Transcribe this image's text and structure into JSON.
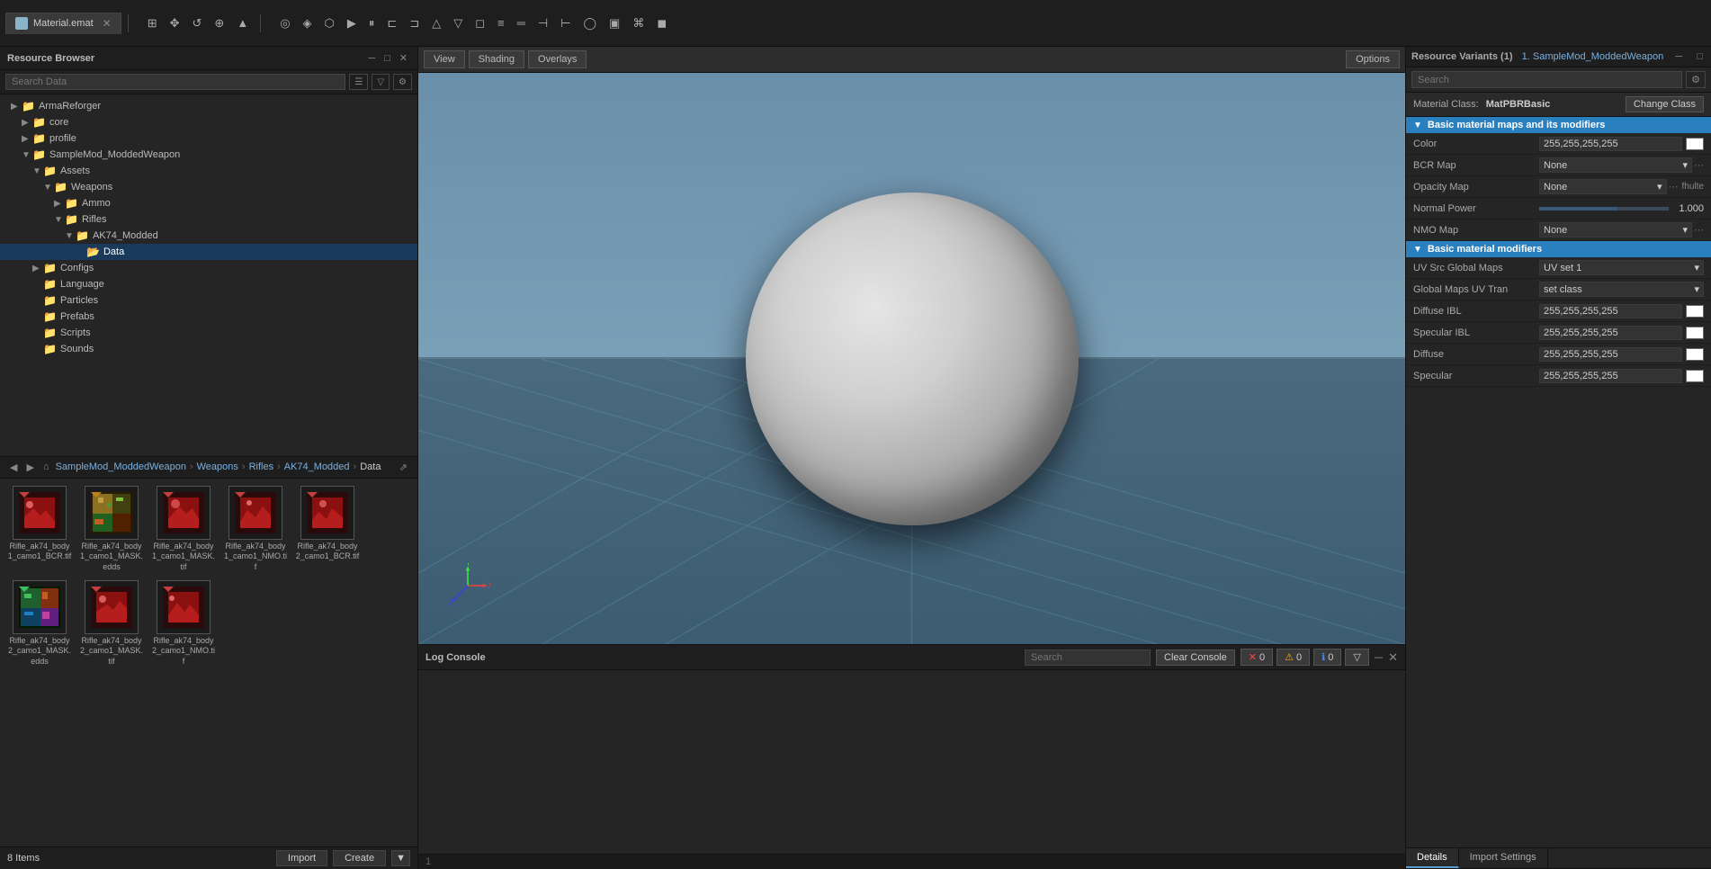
{
  "resource_browser": {
    "title": "Resource Browser",
    "search_placeholder": "Search Data",
    "items_count": "8 Items",
    "tree": [
      {
        "id": "ArmaReforger",
        "label": "ArmaReforger",
        "level": 0,
        "type": "folder",
        "expanded": true
      },
      {
        "id": "core",
        "label": "core",
        "level": 1,
        "type": "folder",
        "expanded": false
      },
      {
        "id": "profile",
        "label": "profile",
        "level": 1,
        "type": "folder",
        "expanded": false
      },
      {
        "id": "SampleMod_ModdedWeapon",
        "label": "SampleMod_ModdedWeapon",
        "level": 1,
        "type": "folder",
        "expanded": true
      },
      {
        "id": "Assets",
        "label": "Assets",
        "level": 2,
        "type": "folder",
        "expanded": true
      },
      {
        "id": "Weapons",
        "label": "Weapons",
        "level": 3,
        "type": "folder",
        "expanded": true
      },
      {
        "id": "Ammo",
        "label": "Ammo",
        "level": 4,
        "type": "folder",
        "expanded": false
      },
      {
        "id": "Rifles",
        "label": "Rifles",
        "level": 4,
        "type": "folder",
        "expanded": true
      },
      {
        "id": "AK74_Modded",
        "label": "AK74_Modded",
        "level": 5,
        "type": "folder",
        "expanded": true
      },
      {
        "id": "Data",
        "label": "Data",
        "level": 6,
        "type": "folder_selected",
        "expanded": true
      },
      {
        "id": "Configs",
        "label": "Configs",
        "level": 2,
        "type": "folder",
        "expanded": false
      },
      {
        "id": "Language",
        "label": "Language",
        "level": 2,
        "type": "folder",
        "expanded": false
      },
      {
        "id": "Particles",
        "label": "Particles",
        "level": 2,
        "type": "folder",
        "expanded": false
      },
      {
        "id": "Prefabs",
        "label": "Prefabs",
        "level": 2,
        "type": "folder",
        "expanded": false
      },
      {
        "id": "Scripts",
        "label": "Scripts",
        "level": 2,
        "type": "folder",
        "expanded": false
      },
      {
        "id": "Sounds",
        "label": "Sounds",
        "level": 2,
        "type": "folder",
        "expanded": false
      }
    ],
    "breadcrumb": [
      "SampleMod_ModdedWeapon",
      "Weapons",
      "Rifles",
      "AK74_Modded",
      "Data"
    ],
    "files": [
      {
        "name": "Rifle_ak74_body1_camo1_BCR.tif",
        "type": "red_image"
      },
      {
        "name": "Rifle_ak74_body1_camo1_MASK.edds",
        "type": "colored_image"
      },
      {
        "name": "Rifle_ak74_body1_camo1_MASK.tif",
        "type": "red_image"
      },
      {
        "name": "Rifle_ak74_body1_camo1_NMO.tif",
        "type": "red_image"
      },
      {
        "name": "Rifle_ak74_body2_camo1_BCR.tif",
        "type": "red_image"
      },
      {
        "name": "Rifle_ak74_body2_camo1_MASK.edds",
        "type": "colored_image2"
      },
      {
        "name": "Rifle_ak74_body2_camo1_MASK.tif",
        "type": "red_image"
      },
      {
        "name": "Rifle_ak74_body2_camo1_NMO.tif",
        "type": "red_image"
      }
    ],
    "import_btn": "Import",
    "create_btn": "Create"
  },
  "viewport": {
    "tab_label": "Material.emat",
    "view_btn": "View",
    "shading_btn": "Shading",
    "overlays_btn": "Overlays",
    "options_btn": "Options"
  },
  "log_console": {
    "title": "Log Console",
    "search_placeholder": "Search",
    "clear_btn": "Clear Console",
    "error_count": "0",
    "warning_count": "0",
    "info_count": "0"
  },
  "right_panel": {
    "title": "Resource Variants (1)",
    "variant_name": "1. SampleMod_ModdedWeapon",
    "material_class_label": "Material Class:",
    "material_class_value": "MatPBRBasic",
    "change_class_btn": "Change Class",
    "search_placeholder": "Search",
    "section1_title": "Basic material maps and its modifiers",
    "section2_title": "Basic material modifiers",
    "props": [
      {
        "label": "Color",
        "value": "255,255,255,255",
        "has_swatch": true
      },
      {
        "label": "BCR Map",
        "value": "None",
        "type": "dropdown",
        "has_dots": true
      },
      {
        "label": "Opacity Map",
        "value": "None",
        "type": "dropdown",
        "has_dots": true,
        "inline": "fhulte"
      },
      {
        "label": "Normal Power",
        "value": "1.000",
        "type": "slider"
      },
      {
        "label": "NMO Map",
        "value": "None",
        "type": "dropdown",
        "has_dots": true
      }
    ],
    "section2_props": [
      {
        "label": "UV Src Global Maps",
        "value": "UV set 1",
        "type": "dropdown"
      },
      {
        "label": "Global Maps UV Tran",
        "value": "set class",
        "type": "dropdown"
      },
      {
        "label": "Diffuse IBL",
        "value": "255,255,255,255",
        "has_swatch": true
      },
      {
        "label": "Specular IBL",
        "value": "255,255,255,255",
        "has_swatch": true
      },
      {
        "label": "Diffuse",
        "value": "255,255,255,255",
        "has_swatch": true
      },
      {
        "label": "Specular",
        "value": "255,255,255,255",
        "has_swatch": true
      }
    ],
    "tab_details": "Details",
    "tab_import_settings": "Import Settings"
  },
  "toolbar": {
    "buttons": [
      "⊞",
      "↔",
      "↕",
      "◉",
      "▲",
      "⊕",
      "◈",
      "⬡",
      "▶",
      "⏸",
      "⊏",
      "⊐",
      "△",
      "▽",
      "◻",
      "≡",
      "═",
      "⊣",
      "⊢",
      "◯",
      "▣",
      "⌘",
      "◼"
    ]
  }
}
